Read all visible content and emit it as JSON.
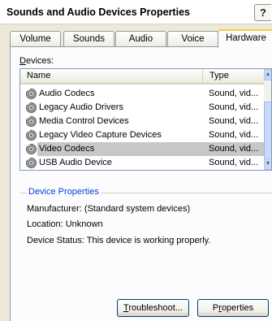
{
  "window": {
    "title": "Sounds and Audio Devices Properties",
    "help_glyph": "?"
  },
  "tabs": [
    {
      "label": "Volume"
    },
    {
      "label": "Sounds"
    },
    {
      "label": "Audio"
    },
    {
      "label": "Voice"
    },
    {
      "label": "Hardware",
      "active": true
    }
  ],
  "devices": {
    "label_accel": "D",
    "label_rest": "evices:",
    "columns": {
      "name": "Name",
      "type": "Type"
    },
    "rows": [
      {
        "name": "Audio Codecs",
        "type": "Sound, vid...",
        "selected": false
      },
      {
        "name": "Legacy Audio Drivers",
        "type": "Sound, vid...",
        "selected": false
      },
      {
        "name": "Media Control Devices",
        "type": "Sound, vid...",
        "selected": false
      },
      {
        "name": "Legacy Video Capture Devices",
        "type": "Sound, vid...",
        "selected": false
      },
      {
        "name": "Video Codecs",
        "type": "Sound, vid...",
        "selected": true
      },
      {
        "name": "USB Audio Device",
        "type": "Sound, vid...",
        "selected": false
      }
    ],
    "device_icon": "speaker-icon"
  },
  "properties": {
    "title": "Device Properties",
    "manufacturer": "Manufacturer: (Standard system devices)",
    "location": "Location: Unknown",
    "status": "Device Status: This device is working properly."
  },
  "buttons": {
    "troubleshoot_accel": "T",
    "troubleshoot_rest": "roubleshoot...",
    "properties_accel": "r",
    "properties_pre": "P",
    "properties_rest": "operties"
  },
  "colors": {
    "group_title": "#0046d5",
    "selected_row": "#c7c7c7",
    "active_tab_accent": "#ffc83c"
  }
}
